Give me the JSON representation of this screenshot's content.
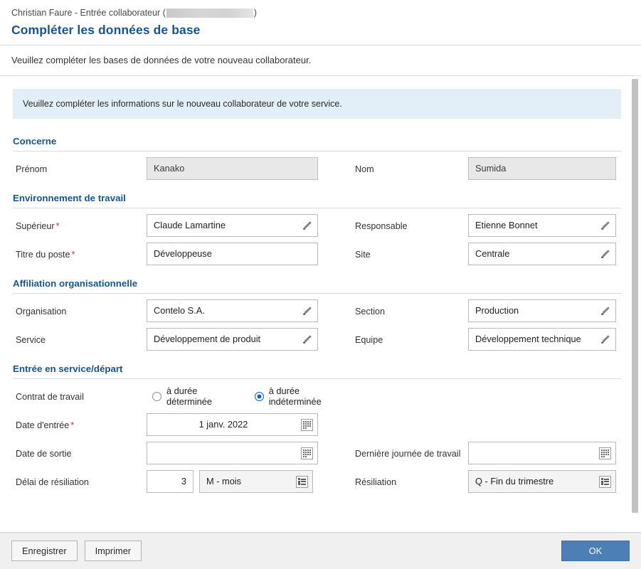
{
  "header": {
    "breadcrumb_prefix": "Christian Faure - Entrée collaborateur (",
    "breadcrumb_suffix": ")",
    "title": "Compléter les données de base"
  },
  "subtitle": "Veuillez compléter les bases de données de votre nouveau collaborateur.",
  "info_banner": "Veuillez compléter les informations sur le nouveau collaborateur de votre service.",
  "colors": {
    "accent_blue": "#16558f",
    "banner_bg": "#e3eff8",
    "primary_button": "#4b7fb5",
    "required_marker": "#c0392b",
    "radio_selected": "#0a64c8"
  },
  "sections": [
    {
      "key": "concerne",
      "title": "Concerne",
      "rows": [
        {
          "left": {
            "label": "Prénom",
            "required": false,
            "value": "Kanako",
            "control": "readonly"
          },
          "right": {
            "label": "Nom",
            "required": false,
            "value": "Sumida",
            "control": "readonly"
          }
        }
      ]
    },
    {
      "key": "environnement",
      "title": "Environnement de travail",
      "rows": [
        {
          "left": {
            "label": "Supérieur",
            "required": true,
            "value": "Claude Lamartine",
            "control": "picker",
            "icon": "pencil-icon"
          },
          "right": {
            "label": "Responsable",
            "required": false,
            "value": "Etienne Bonnet",
            "control": "picker",
            "icon": "pencil-icon"
          }
        },
        {
          "left": {
            "label": "Titre du poste",
            "required": true,
            "value": "Développeuse",
            "control": "text"
          },
          "right": {
            "label": "Site",
            "required": false,
            "value": "Centrale",
            "control": "picker",
            "icon": "pencil-icon"
          }
        }
      ]
    },
    {
      "key": "affiliation",
      "title": "Affiliation organisationnelle",
      "rows": [
        {
          "left": {
            "label": "Organisation",
            "required": false,
            "value": "Contelo S.A.",
            "control": "picker",
            "icon": "pencil-icon"
          },
          "right": {
            "label": "Section",
            "required": false,
            "value": "Production",
            "control": "picker",
            "icon": "pencil-icon"
          }
        },
        {
          "left": {
            "label": "Service",
            "required": false,
            "value": "Développement de produit",
            "control": "picker",
            "icon": "pencil-icon"
          },
          "right": {
            "label": "Equipe",
            "required": false,
            "value": "Développement technique",
            "control": "picker",
            "icon": "pencil-icon"
          }
        }
      ]
    },
    {
      "key": "entree",
      "title": "Entrée en service/départ"
    }
  ],
  "contract": {
    "label": "Contrat de travail",
    "options": [
      {
        "label": "à durée déterminée",
        "selected": false
      },
      {
        "label": "à durée indéterminée",
        "selected": true
      }
    ]
  },
  "dates": {
    "entry": {
      "label": "Date d'entrée",
      "required": true,
      "value": "1 janv. 2022",
      "icon": "calendar-icon"
    },
    "exit": {
      "label": "Date de sortie",
      "required": false,
      "value": "",
      "icon": "calendar-icon"
    },
    "last_working_day": {
      "label": "Dernière journée de travail",
      "required": false,
      "value": "",
      "icon": "calendar-icon"
    }
  },
  "termination": {
    "notice_label": "Délai de résiliation",
    "notice_value": "3",
    "notice_unit": "M - mois",
    "notice_unit_icon": "list-icon",
    "resiliation_label": "Résiliation",
    "resiliation_value": "Q - Fin du trimestre",
    "resiliation_icon": "list-icon"
  },
  "footer": {
    "save_label": "Enregistrer",
    "print_label": "Imprimer",
    "ok_label": "OK"
  }
}
